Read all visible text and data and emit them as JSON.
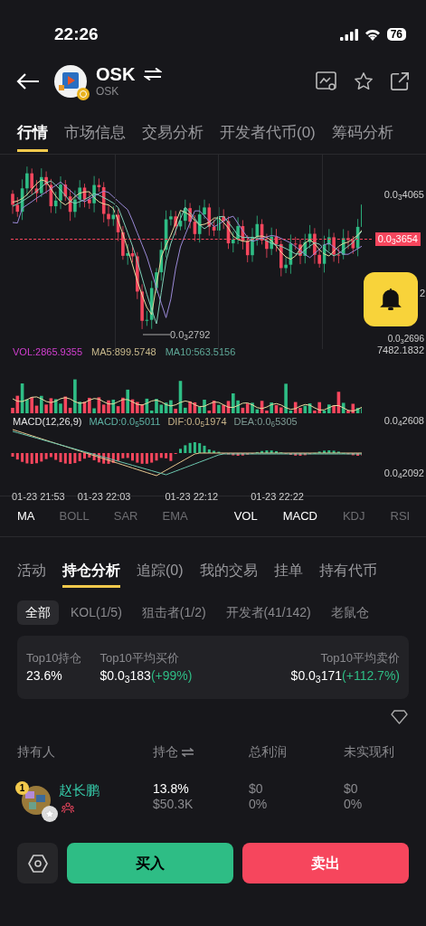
{
  "status_bar": {
    "time": "22:26",
    "battery": "76"
  },
  "header": {
    "title": "OSK",
    "subtitle": "OSK"
  },
  "tabs": [
    {
      "label": "行情",
      "selected": true
    },
    {
      "label": "市场信息",
      "selected": false
    },
    {
      "label": "交易分析",
      "selected": false
    },
    {
      "label": "开发者代币(0)",
      "selected": false
    },
    {
      "label": "筹码分析",
      "selected": false
    }
  ],
  "chart": {
    "y_labels": [
      "0.0$_{3}$4065",
      "2"
    ],
    "price_tag": "0.0$_{3}$3654",
    "low_marker": "0.0$_{3}$2792",
    "bottom_label": "0.0$_{3}$2696",
    "volume_legend": [
      {
        "text": "VOL:2865.9355",
        "color": "#d23fd0"
      },
      {
        "text": "MA5:899.5748",
        "color": "#c8b98c"
      },
      {
        "text": "MA10:563.5156",
        "color": "#5fa898"
      }
    ],
    "volume_max": "7482.1832",
    "macd_legend": [
      {
        "text": "MACD(12,26,9)",
        "color": "#e6e6e6"
      },
      {
        "text": "MACD:0.0$_{5}$5011",
        "color": "#5fb3a5"
      },
      {
        "text": "DIF:0.0$_{5}$1974",
        "color": "#c8b48a"
      },
      {
        "text": "DEA:0.0$_{6}$5305",
        "color": "#7f9c95"
      }
    ],
    "macd_labels": [
      "0.0$_{4}$2608",
      "0.0$_{4}$2092"
    ],
    "time_labels": [
      "01-23 21:53",
      "01-23 22:03",
      "01-23 22:12",
      "01-23 22:22"
    ]
  },
  "main_indicators": [
    {
      "label": "MA",
      "selected": true
    },
    {
      "label": "BOLL",
      "selected": false
    },
    {
      "label": "SAR",
      "selected": false
    },
    {
      "label": "EMA",
      "selected": false
    }
  ],
  "sub_indicators": [
    {
      "label": "VOL",
      "selected": true
    },
    {
      "label": "MACD",
      "selected": true
    },
    {
      "label": "KDJ",
      "selected": false
    },
    {
      "label": "RSI",
      "selected": false
    }
  ],
  "section_tabs": [
    {
      "label": "活动",
      "selected": false
    },
    {
      "label": "持仓分析",
      "selected": true
    },
    {
      "label": "追踪(0)",
      "selected": false
    },
    {
      "label": "我的交易",
      "selected": false
    },
    {
      "label": "挂单",
      "selected": false
    },
    {
      "label": "持有代币",
      "selected": false
    }
  ],
  "filters": [
    {
      "label": "全部",
      "selected": true
    },
    {
      "label": "KOL(1/5)",
      "selected": false
    },
    {
      "label": "狙击者(1/2)",
      "selected": false
    },
    {
      "label": "开发者(41/142)",
      "selected": false
    },
    {
      "label": "老鼠仓",
      "selected": false
    }
  ],
  "stats": [
    {
      "label": "Top10持仓",
      "value": "23.6%"
    },
    {
      "label": "Top10平均买价",
      "value": "$0.0$_{3}$183",
      "change": "(+99%)"
    },
    {
      "label": "Top10平均卖价",
      "value": "$0.0$_{3}$171",
      "change": "(+112.7%)"
    }
  ],
  "table": {
    "columns": [
      "持有人",
      "持仓",
      "总利润",
      "未实现利"
    ],
    "rows": [
      {
        "rank": "1",
        "name": "赵长鹏",
        "holding": "13.8%",
        "holding_value": "$50.3K",
        "profit": "$0",
        "profit_pct": "0%",
        "unrealized": "$0",
        "unrealized_pct": "0%"
      }
    ]
  },
  "actions": {
    "buy": "买入",
    "sell": "卖出"
  }
}
